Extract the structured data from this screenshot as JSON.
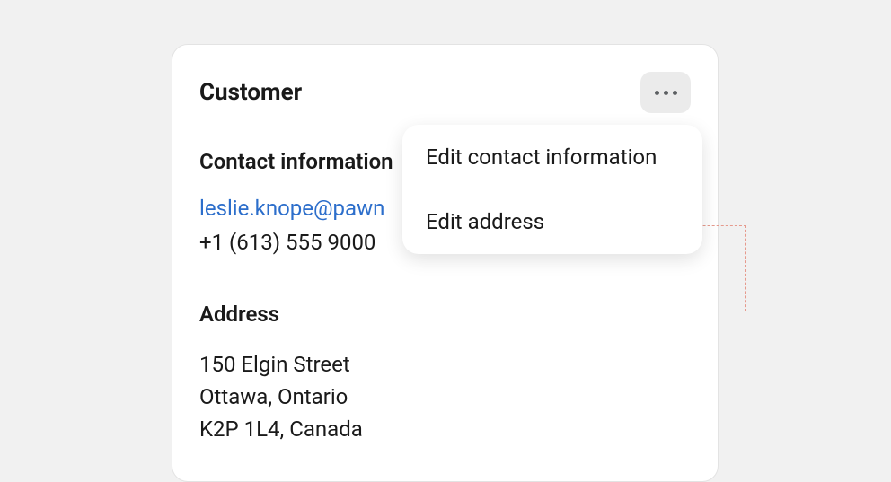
{
  "card": {
    "title": "Customer",
    "contact": {
      "heading": "Contact information",
      "email": "leslie.knope@pawn",
      "phone": "+1 (613) 555 9000"
    },
    "address": {
      "heading": "Address",
      "line1": "150 Elgin Street",
      "line2": "Ottawa, Ontario",
      "line3": "K2P 1L4, Canada"
    }
  },
  "popover": {
    "items": [
      {
        "label": "Edit contact information"
      },
      {
        "label": "Edit address"
      }
    ]
  }
}
